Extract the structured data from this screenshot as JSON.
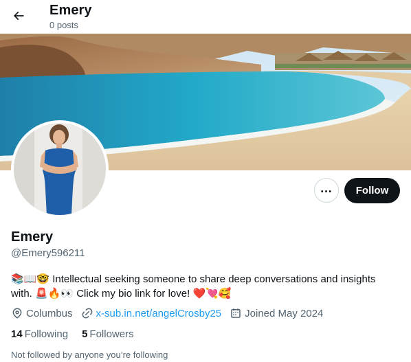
{
  "header": {
    "name": "Emery",
    "posts_label": "0 posts"
  },
  "profile": {
    "display_name": "Emery",
    "handle": "@Emery596211",
    "bio_line1_emoji": "📚📖🤓",
    "bio_line1_text": " Intellectual seeking someone to share deep conversations and insights",
    "bio_line2_text_a": "with. ",
    "bio_line2_emoji": "🚨🔥👀",
    "bio_line2_text_b": " Click my bio link for love! ",
    "bio_line2_emoji_end": "❤️💘🥰",
    "location": "Columbus",
    "link": "x-sub.in.net/angelCrosby25",
    "joined": "Joined May 2024",
    "following_count": "14",
    "following_label": "Following",
    "followers_count": "5",
    "followers_label": "Followers",
    "not_followed_text": "Not followed by anyone you’re following"
  },
  "actions": {
    "more_label": "…",
    "follow_label": "Follow"
  },
  "icons": {
    "back": "arrow-left-icon",
    "location": "location-pin-icon",
    "link": "link-icon",
    "calendar": "calendar-icon"
  },
  "colors": {
    "text_primary": "#0f1419",
    "text_secondary": "#536471",
    "link": "#1d9bf0",
    "follow_button": "#0f1419"
  }
}
